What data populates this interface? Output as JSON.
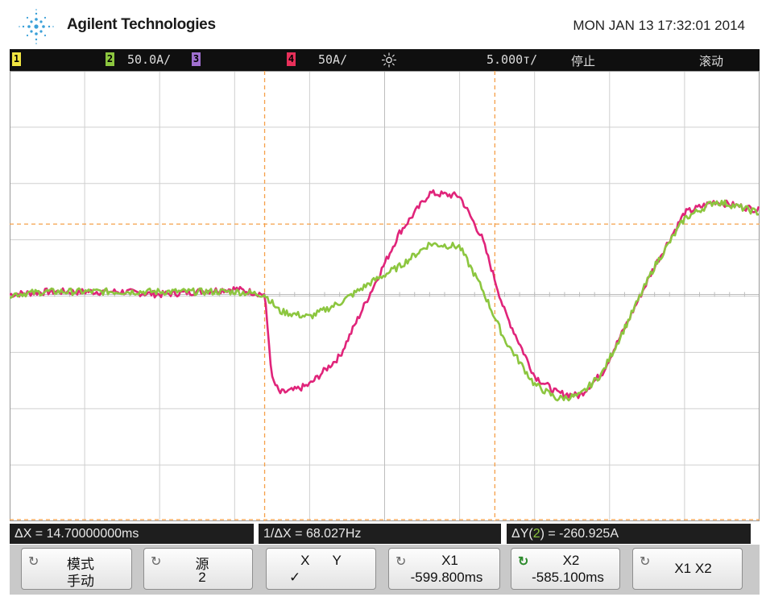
{
  "header": {
    "brand": "Agilent Technologies",
    "datetime": "MON JAN 13 17:32:01 2014"
  },
  "status_bar": {
    "ch1_label": "1",
    "ch2_label": "2",
    "ch2_scale": "50.0A/",
    "ch3_label": "3",
    "ch4_label": "4",
    "ch4_scale": "50A/",
    "timebase": "5.000т/",
    "run_state": "停止",
    "mode": "滚动"
  },
  "readouts": {
    "delta_x": "ΔX = 14.70000000ms",
    "inv_delta_x": "1/ΔX = 68.027Hz",
    "delta_y_prefix": "ΔY(",
    "delta_y_channel": "2",
    "delta_y_suffix": ") = -260.925A"
  },
  "softkeys": [
    {
      "line1": "模式",
      "line2": "手动"
    },
    {
      "line1": "源",
      "line2": "2"
    },
    {
      "line1": "X      Y",
      "line2": "✓"
    },
    {
      "line1": "X1",
      "line2": "-599.800ms"
    },
    {
      "line1": "X2",
      "line2": "-585.100ms"
    },
    {
      "line1": "X1 X2",
      "line2": ""
    }
  ],
  "colors": {
    "ch2_green": "#8cc63f",
    "ch4_magenta": "#e0247a",
    "cursor_orange": "#f5a04a",
    "ch1_yellow": "#f0e442",
    "ch3_purple": "#a070d0",
    "ch4_red": "#e8305a"
  },
  "chart_data": {
    "type": "line",
    "x_divisions": 10,
    "y_divisions": 8,
    "series": [
      {
        "channel": "4",
        "x": [
          0,
          0.5,
          1,
          1.5,
          2,
          2.5,
          3,
          3.4,
          3.5,
          3.6,
          3.8,
          4,
          4.4,
          4.8,
          5.2,
          5.6,
          6,
          6.3,
          6.6,
          7,
          7.3,
          7.6,
          7.9,
          8.2,
          8.6,
          9,
          9.4,
          9.6,
          10
        ],
        "y": [
          0,
          0.05,
          0.05,
          0.05,
          0,
          0.05,
          0.1,
          0,
          -1.5,
          -1.75,
          -1.7,
          -1.6,
          -1.1,
          0,
          1.1,
          1.8,
          1.75,
          1.0,
          -0.3,
          -1.45,
          -1.75,
          -1.8,
          -1.4,
          -0.6,
          0.5,
          1.45,
          1.65,
          1.6,
          1.5
        ]
      },
      {
        "channel": "2",
        "x": [
          0,
          0.5,
          1,
          1.5,
          2,
          2.5,
          3,
          3.4,
          3.6,
          4,
          4.4,
          4.8,
          5.2,
          5.6,
          6,
          6.3,
          6.6,
          7,
          7.3,
          7.6,
          7.9,
          8.2,
          8.6,
          9,
          9.4,
          9.6,
          10
        ],
        "y": [
          0,
          0.05,
          0.05,
          0.05,
          0.05,
          0.05,
          0.05,
          0,
          -0.3,
          -0.4,
          -0.15,
          0.2,
          0.5,
          0.9,
          0.85,
          0.1,
          -0.8,
          -1.6,
          -1.85,
          -1.8,
          -1.4,
          -0.6,
          0.5,
          1.35,
          1.65,
          1.6,
          1.45
        ]
      }
    ],
    "x_cursors_div": [
      3.4,
      6.47
    ],
    "y_cursors_div": [
      1.25,
      -4
    ]
  }
}
